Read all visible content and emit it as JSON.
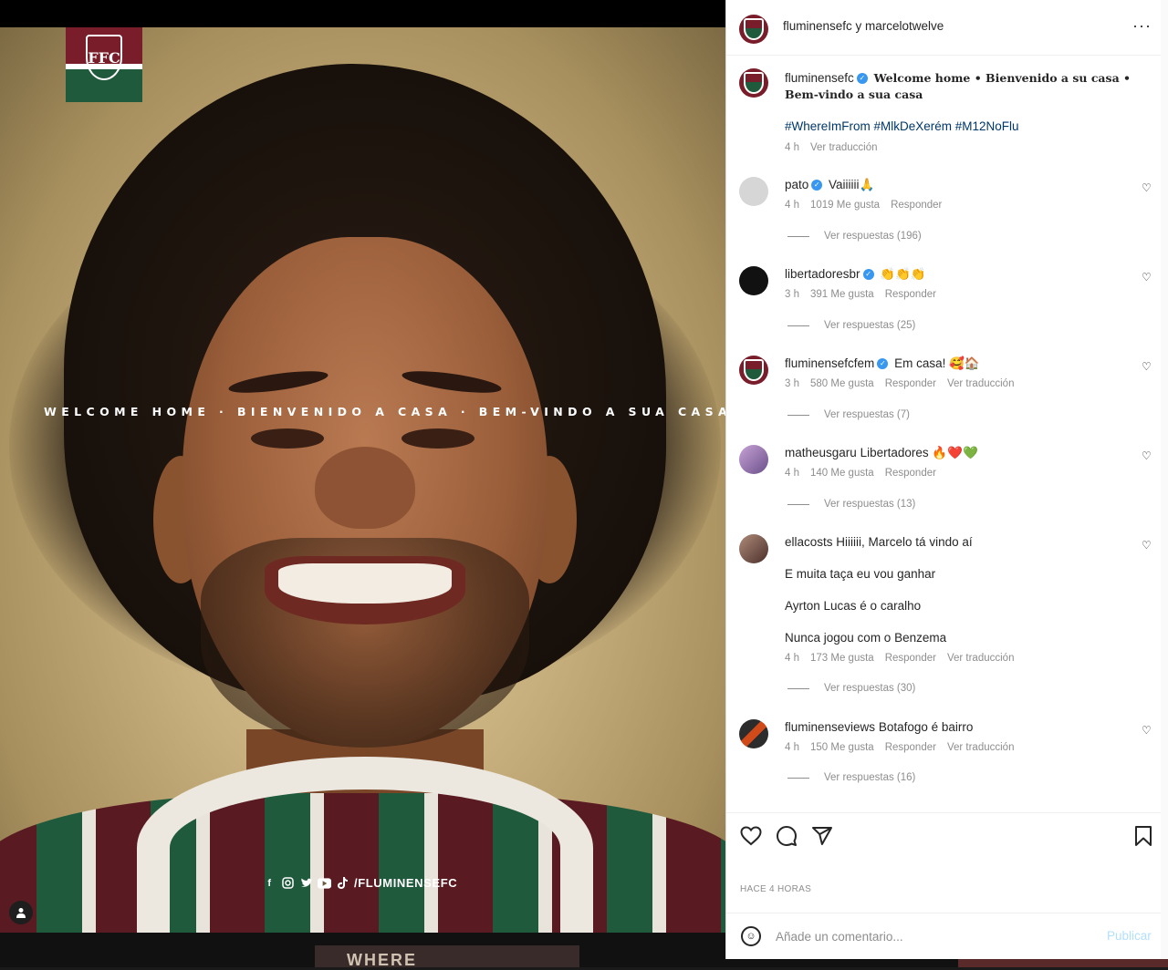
{
  "post_image": {
    "headline": "WELCOME HOME · BIENVENIDO A CASA · BEM-VINDO A SUA CASA",
    "club_initials": "FFC",
    "social_handle": "/FLUMINENSEFC",
    "social_icons": [
      "facebook-icon",
      "instagram-icon",
      "twitter-icon",
      "youtube-icon",
      "tiktok-icon"
    ],
    "bottom_strip_text": "WHERE",
    "colors": {
      "maroon": "#7a1d2a",
      "green": "#1f5a3c"
    }
  },
  "header": {
    "users": "fluminensefc y marcelotwelve",
    "more": "···"
  },
  "caption": {
    "user": "fluminensefc",
    "text": "Welcome home • Bienvenido a su casa • Bem-vindo a sua casa",
    "hashtags": "#WhereImFrom #MlkDeXerém #M12NoFlu",
    "time": "4 h",
    "translate": "Ver traducción"
  },
  "comments": [
    {
      "user": "pato",
      "verified": true,
      "text": "Vaiiiiii🙏",
      "time": "4 h",
      "likes": "1019 Me gusta",
      "reply": "Responder",
      "translate": "",
      "replies": "Ver respuestas (196)"
    },
    {
      "user": "libertadoresbr",
      "verified": true,
      "text": "👏👏👏",
      "time": "3 h",
      "likes": "391 Me gusta",
      "reply": "Responder",
      "translate": "",
      "replies": "Ver respuestas (25)"
    },
    {
      "user": "fluminensefcfem",
      "verified": true,
      "text": "Em casa! 🥰🏠",
      "time": "3 h",
      "likes": "580 Me gusta",
      "reply": "Responder",
      "translate": "Ver traducción",
      "replies": "Ver respuestas (7)"
    },
    {
      "user": "matheusgaru",
      "verified": false,
      "text": "Libertadores 🔥❤️💚",
      "time": "4 h",
      "likes": "140 Me gusta",
      "reply": "Responder",
      "translate": "",
      "replies": "Ver respuestas (13)"
    },
    {
      "user": "ellacosts",
      "verified": false,
      "text": "Hiiiiii, Marcelo tá vindo aí",
      "extra_lines": [
        "E muita taça eu vou ganhar",
        "Ayrton Lucas é o caralho",
        "Nunca jogou com o Benzema"
      ],
      "time": "4 h",
      "likes": "173 Me gusta",
      "reply": "Responder",
      "translate": "Ver traducción",
      "replies": "Ver respuestas (30)"
    },
    {
      "user": "fluminenseviews",
      "verified": false,
      "text": "Botafogo é bairro",
      "time": "4 h",
      "likes": "150 Me gusta",
      "reply": "Responder",
      "translate": "Ver traducción",
      "replies": "Ver respuestas (16)"
    }
  ],
  "actions": {
    "time_ago": "HACE 4 HORAS"
  },
  "add_comment": {
    "placeholder": "Añade un comentario...",
    "publish": "Publicar"
  }
}
